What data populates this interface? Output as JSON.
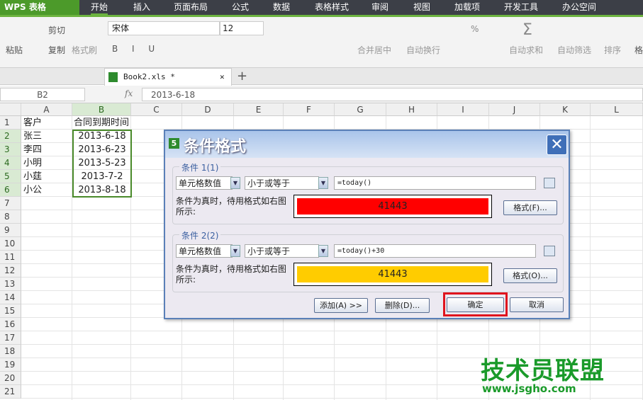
{
  "app": {
    "logo": "WPS 表格"
  },
  "menu": [
    "开始",
    "插入",
    "页面布局",
    "公式",
    "数据",
    "表格样式",
    "审阅",
    "视图",
    "加载项",
    "开发工具",
    "办公空间"
  ],
  "ribbon": {
    "paste": "粘贴",
    "cut": "剪切",
    "copy": "复制",
    "format_painter": "格式刷",
    "font": "宋体",
    "font_size": "12",
    "merge": "合并居中",
    "wrap": "自动换行",
    "autosum": "自动求和",
    "autofilter": "自动筛选",
    "sort": "排序",
    "format": "格"
  },
  "doc_tab": {
    "name": "Book2.xls *"
  },
  "formula_bar": {
    "name_box": "B2",
    "fx": "fx",
    "value": "2013-6-18"
  },
  "columns": [
    "A",
    "B",
    "C",
    "D",
    "E",
    "F",
    "G",
    "H",
    "I",
    "J",
    "K",
    "L"
  ],
  "rows": [
    "1",
    "2",
    "3",
    "4",
    "5",
    "6",
    "7",
    "8",
    "9",
    "10",
    "11",
    "12",
    "13",
    "14",
    "15",
    "16",
    "17",
    "18",
    "19",
    "20",
    "21"
  ],
  "cells": [
    [
      "客户",
      "合同到期时间"
    ],
    [
      "张三",
      "2013-6-18"
    ],
    [
      "李四",
      "2013-6-23"
    ],
    [
      "小明",
      "2013-5-23"
    ],
    [
      "小莛",
      "2013-7-2"
    ],
    [
      "小公",
      "2013-8-18"
    ]
  ],
  "dialog": {
    "title": "条件格式",
    "conditions": [
      {
        "label": "条件 1(1)",
        "type": "单元格数值",
        "operator": "小于或等于",
        "formula": "=today()",
        "note": "条件为真时，待用格式如右图所示:",
        "preview": "41443",
        "preview_color": "#ff0000",
        "format_button": "格式(F)..."
      },
      {
        "label": "条件 2(2)",
        "type": "单元格数值",
        "operator": "小于或等于",
        "formula": "=today()+30",
        "note": "条件为真时，待用格式如右图所示:",
        "preview": "41443",
        "preview_color": "#ffcc00",
        "format_button": "格式(O)..."
      }
    ],
    "add": "添加(A) >>",
    "delete": "删除(D)...",
    "ok": "确定",
    "cancel": "取消"
  },
  "watermark": {
    "text": "技术员联盟",
    "url": "www.jsgho.com"
  }
}
